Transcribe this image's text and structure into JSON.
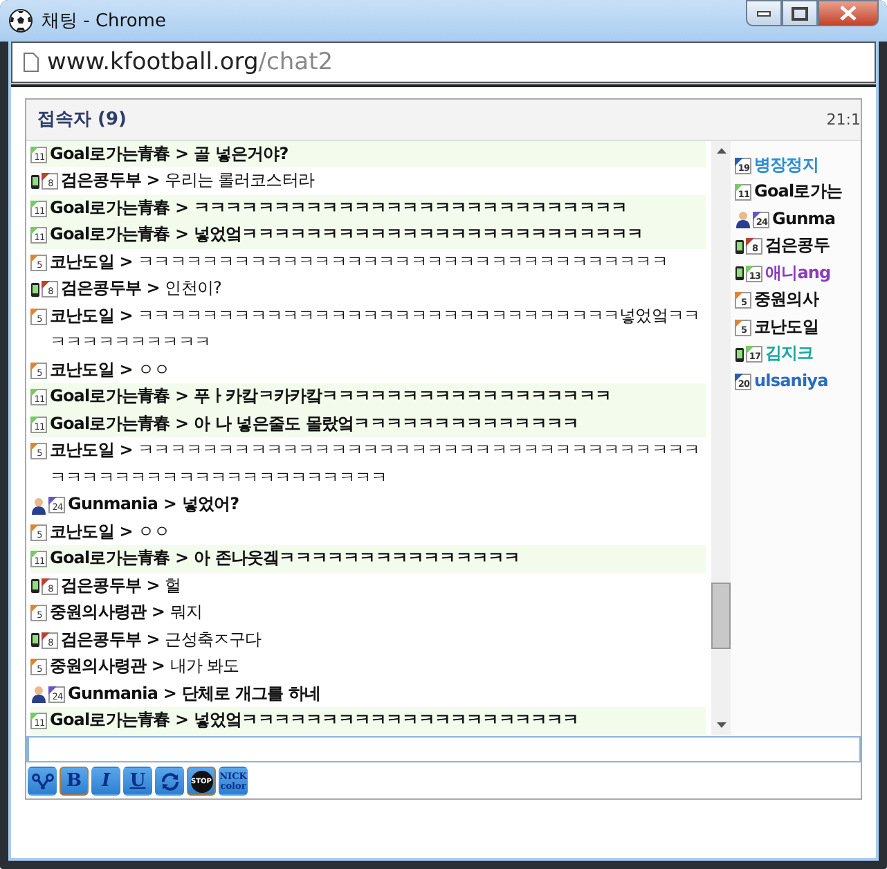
{
  "window": {
    "title": "채팅 - Chrome"
  },
  "address_bar": {
    "host": "www.kfootball.org",
    "path": "/chat2"
  },
  "header": {
    "title": "접속자 (9)",
    "time": "21:1"
  },
  "messages": [
    {
      "nick": "Goal로가는青春",
      "sep": ">",
      "badge": {
        "level": "11",
        "color": "#7cc76a"
      },
      "mobile": false,
      "avatar": false,
      "highlighted": true,
      "bold": true,
      "text": "골 넣은거야?"
    },
    {
      "nick": "검은콩두부",
      "sep": ">",
      "badge": {
        "level": "8",
        "color": "#b8432f"
      },
      "mobile": true,
      "avatar": false,
      "highlighted": false,
      "bold": false,
      "text": "우리는 롤러코스터라"
    },
    {
      "nick": "Goal로가는青春",
      "sep": ">",
      "badge": {
        "level": "11",
        "color": "#7cc76a"
      },
      "mobile": false,
      "avatar": false,
      "highlighted": true,
      "bold": true,
      "text": "ㅋㅋㅋㅋㅋㅋㅋㅋㅋㅋㅋㅋㅋㅋㅋㅋㅋㅋㅋㅋㅋㅋㅋㅋㅋㅋㅋ"
    },
    {
      "nick": "Goal로가는青春",
      "sep": ">",
      "badge": {
        "level": "11",
        "color": "#7cc76a"
      },
      "mobile": false,
      "avatar": false,
      "highlighted": true,
      "bold": true,
      "text": "넣었엌ㅋㅋㅋㅋㅋㅋㅋㅋㅋㅋㅋㅋㅋㅋㅋㅋㅋㅋㅋㅋㅋㅋㅋㅋㅋ"
    },
    {
      "nick": "코난도일",
      "sep": ">",
      "badge": {
        "level": "5",
        "color": "#d9863a"
      },
      "mobile": false,
      "avatar": false,
      "highlighted": false,
      "bold": false,
      "text": "ㅋㅋㅋㅋㅋㅋㅋㅋㅋㅋㅋㅋㅋㅋㅋㅋㅋㅋㅋㅋㅋㅋㅋㅋㅋㅋㅋㅋㅋㅋㅋㅋㅋ"
    },
    {
      "nick": "검은콩두부",
      "sep": ">",
      "badge": {
        "level": "8",
        "color": "#b8432f"
      },
      "mobile": true,
      "avatar": false,
      "highlighted": false,
      "bold": false,
      "text": "인천이?"
    },
    {
      "nick": "코난도일",
      "sep": ">",
      "badge": {
        "level": "5",
        "color": "#d9863a"
      },
      "mobile": false,
      "avatar": false,
      "highlighted": false,
      "bold": false,
      "text": "ㅋㅋㅋㅋㅋㅋㅋㅋㅋㅋㅋㅋㅋㅋㅋㅋㅋㅋㅋㅋㅋㅋㅋㅋㅋㅋㅋㅋㅋㅋ넣었엌ㅋㅋㅋㅋㅋㅋㅋㅋㅋㅋㅋㅋ"
    },
    {
      "nick": "코난도일",
      "sep": ">",
      "badge": {
        "level": "5",
        "color": "#d9863a"
      },
      "mobile": false,
      "avatar": false,
      "highlighted": false,
      "bold": false,
      "text": "ㅇㅇ"
    },
    {
      "nick": "Goal로가는青春",
      "sep": ">",
      "badge": {
        "level": "11",
        "color": "#7cc76a"
      },
      "mobile": false,
      "avatar": false,
      "highlighted": true,
      "bold": true,
      "text": "푸ㅏ카캌ㅋ카카캌ㅋㅋㅋㅋㅋㅋㅋㅋㅋㅋㅋㅋㅋㅋㅋㅋㅋㅋ"
    },
    {
      "nick": "Goal로가는青春",
      "sep": ">",
      "badge": {
        "level": "11",
        "color": "#7cc76a"
      },
      "mobile": false,
      "avatar": false,
      "highlighted": true,
      "bold": true,
      "text": "아 나 넣은줄도 몰랐엌ㅋㅋㅋㅋㅋㅋㅋㅋㅋㅋㅋㅋㅋㅋ"
    },
    {
      "nick": "코난도일",
      "sep": ">",
      "badge": {
        "level": "5",
        "color": "#d9863a"
      },
      "mobile": false,
      "avatar": false,
      "highlighted": false,
      "bold": false,
      "text": "ㅋㅋㅋㅋㅋㅋㅋㅋㅋㅋㅋㅋㅋㅋㅋㅋㅋㅋㅋㅋㅋㅋㅋㅋㅋㅋㅋㅋㅋㅋㅋㅋㅋㅋㅋㅋㅋㅋㅋㅋㅋㅋㅋㅋㅋㅋㅋㅋㅋㅋㅋㅋㅋㅋㅋㅋ"
    },
    {
      "nick": "Gunmania",
      "sep": ">",
      "badge": {
        "level": "24",
        "color": "#6a52c8"
      },
      "mobile": false,
      "avatar": true,
      "highlighted": false,
      "bold": true,
      "text": "넣었어?"
    },
    {
      "nick": "코난도일",
      "sep": ">",
      "badge": {
        "level": "5",
        "color": "#d9863a"
      },
      "mobile": false,
      "avatar": false,
      "highlighted": false,
      "bold": false,
      "text": "ㅇㅇ"
    },
    {
      "nick": "Goal로가는青春",
      "sep": ">",
      "badge": {
        "level": "11",
        "color": "#7cc76a"
      },
      "mobile": false,
      "avatar": false,
      "highlighted": true,
      "bold": true,
      "text": "아 존나웃겤ㅋㅋㅋㅋㅋㅋㅋㅋㅋㅋㅋㅋㅋㅋㅋ"
    },
    {
      "nick": "검은콩두부",
      "sep": ">",
      "badge": {
        "level": "8",
        "color": "#b8432f"
      },
      "mobile": true,
      "avatar": false,
      "highlighted": false,
      "bold": false,
      "text": "헐"
    },
    {
      "nick": "중원의사령관",
      "sep": ">",
      "badge": {
        "level": "5",
        "color": "#d9863a"
      },
      "mobile": false,
      "avatar": false,
      "highlighted": false,
      "bold": false,
      "text": "뭐지"
    },
    {
      "nick": "검은콩두부",
      "sep": ">",
      "badge": {
        "level": "8",
        "color": "#b8432f"
      },
      "mobile": true,
      "avatar": false,
      "highlighted": false,
      "bold": false,
      "text": "근성축ㅈ구다"
    },
    {
      "nick": "중원의사령관",
      "sep": ">",
      "badge": {
        "level": "5",
        "color": "#d9863a"
      },
      "mobile": false,
      "avatar": false,
      "highlighted": false,
      "bold": false,
      "text": "내가 봐도"
    },
    {
      "nick": "Gunmania",
      "sep": ">",
      "badge": {
        "level": "24",
        "color": "#6a52c8"
      },
      "mobile": false,
      "avatar": true,
      "highlighted": false,
      "bold": true,
      "text": "단체로 개그를 하네"
    },
    {
      "nick": "Goal로가는青春",
      "sep": ">",
      "badge": {
        "level": "11",
        "color": "#7cc76a"
      },
      "mobile": false,
      "avatar": false,
      "highlighted": true,
      "bold": true,
      "text": "넣었엌ㅋㅋㅋㅋㅋㅋㅋㅋㅋㅋㅋㅋㅋㅋㅋㅋㅋㅋㅋㅋㅋ"
    }
  ],
  "users": [
    {
      "nick": "병장정지",
      "badge": {
        "level": "19",
        "color": "#2a5fa8"
      },
      "mobile": false,
      "avatar": false,
      "color": "#2a8fd8"
    },
    {
      "nick": "Goal로가는",
      "badge": {
        "level": "11",
        "color": "#7cc76a"
      },
      "mobile": false,
      "avatar": false,
      "color": "#111111"
    },
    {
      "nick": "Gunma",
      "badge": {
        "level": "24",
        "color": "#6a52c8"
      },
      "mobile": false,
      "avatar": true,
      "color": "#111111"
    },
    {
      "nick": "검은콩두",
      "badge": {
        "level": "8",
        "color": "#b8432f"
      },
      "mobile": true,
      "avatar": false,
      "color": "#111111"
    },
    {
      "nick": "애니ang",
      "badge": {
        "level": "13",
        "color": "#7cc76a"
      },
      "mobile": true,
      "avatar": false,
      "color": "#8a3cc0"
    },
    {
      "nick": "중원의사",
      "badge": {
        "level": "5",
        "color": "#d9863a"
      },
      "mobile": false,
      "avatar": false,
      "color": "#111111"
    },
    {
      "nick": "코난도일",
      "badge": {
        "level": "5",
        "color": "#d9863a"
      },
      "mobile": false,
      "avatar": false,
      "color": "#111111"
    },
    {
      "nick": "김지크",
      "badge": {
        "level": "17",
        "color": "#7cc76a"
      },
      "mobile": true,
      "avatar": false,
      "color": "#1aa8a0"
    },
    {
      "nick": "ulsaniya",
      "badge": {
        "level": "20",
        "color": "#2a5fa8"
      },
      "mobile": false,
      "avatar": false,
      "color": "#2a6cc0"
    }
  ],
  "toolbar": [
    {
      "kind": "scissors",
      "selected": false
    },
    {
      "kind": "bold",
      "label": "B",
      "selected": true
    },
    {
      "kind": "italic",
      "label": "I",
      "selected": false
    },
    {
      "kind": "underline",
      "label": "U",
      "selected": false
    },
    {
      "kind": "refresh",
      "selected": false
    },
    {
      "kind": "stop",
      "label": "STOP",
      "selected": true
    },
    {
      "kind": "nick_color",
      "label": "NICK",
      "sublabel": "color",
      "selected": false
    }
  ]
}
